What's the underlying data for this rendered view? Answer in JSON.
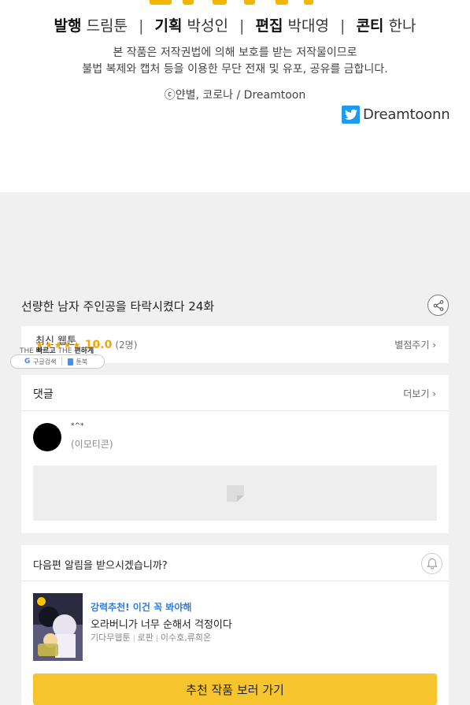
{
  "credits": {
    "publish_label": "발행",
    "publish_value": "드림툰",
    "plan_label": "기획",
    "plan_value": "박성인",
    "edit_label": "편집",
    "edit_value": "박대영",
    "conti_label": "콘티",
    "conti_value": "한나",
    "separator": "|",
    "notice_line1": "본 작품은 저작권법에 의해 보호를 받는 저작물이므로",
    "notice_line2": "불법 복제와 캡처 등을 이용한 무단 전재 및 유포, 공유를 금합니다.",
    "copyright": "ⓒ얀별, 코로나 / Dreamtoon",
    "twitter_handle": "Dreamtoonn",
    "accent_color": "#f2b600",
    "twitter_color": "#1d9bf0"
  },
  "episode": {
    "title": "선량한 남자 주인공을 타락시켰다 24화",
    "share_icon": "share-icon"
  },
  "rating": {
    "label": "최신 웹툰",
    "stars": "★★★★★",
    "score": "10.0",
    "count": "(2명)",
    "rate_link": "별점주기 ›"
  },
  "overlay": {
    "thin_text_a": "THE",
    "thin_text_b": "빠르고",
    "thin_text_c": "THE",
    "thin_text_d": "편하게",
    "search_label": "구글검색",
    "toonbook_label": "툰북"
  },
  "comments": {
    "header": "댓글",
    "more_link": "더보기 ›",
    "author": "*^*",
    "body": "(이모티콘)"
  },
  "notify": {
    "question": "다음편 알림을 받으시겠습니까?",
    "bell_icon": "bell-icon"
  },
  "recommend": {
    "tag": "강력추천! 이건 꼭 봐야해",
    "title": "오라버니가 너무 순해서 걱정이다",
    "genre": "기다무웹툰",
    "category": "로판",
    "authors": "이수호,류희온",
    "cta": "추천 작품 보러 가기",
    "cta_color": "#f6c42c"
  }
}
